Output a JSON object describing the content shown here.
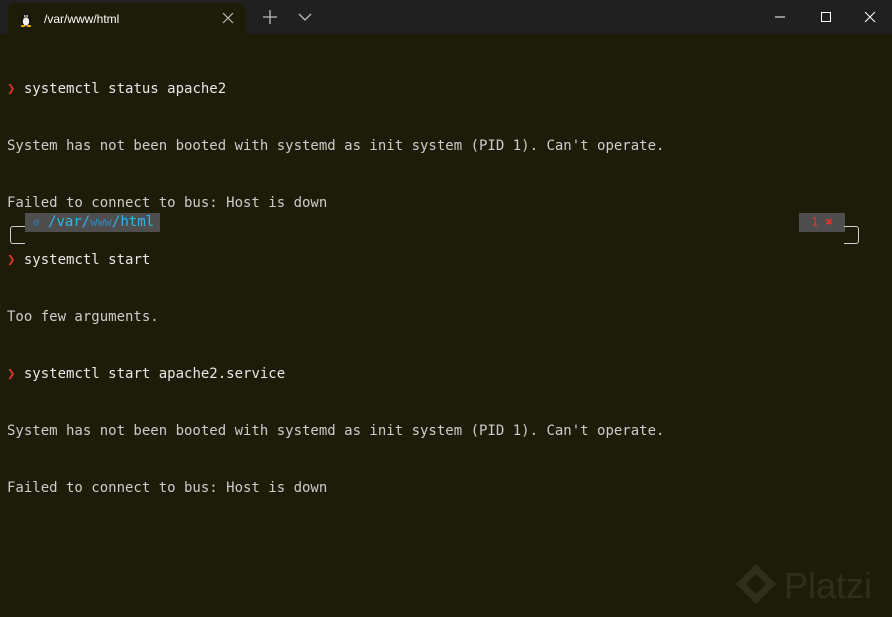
{
  "tab": {
    "title": "/var/www/html",
    "icon": "linux-penguin-icon"
  },
  "window_controls": [
    "minimize-icon",
    "maximize-icon",
    "close-icon"
  ],
  "terminal": {
    "prompt_symbol": "❯",
    "lines": [
      {
        "type": "command",
        "text": "systemctl status apache2"
      },
      {
        "type": "output",
        "text": "System has not been booted with systemd as init system (PID 1). Can't operate."
      },
      {
        "type": "output",
        "text": "Failed to connect to bus: Host is down"
      },
      {
        "type": "command",
        "text": "systemctl start"
      },
      {
        "type": "output",
        "text": "Too few arguments."
      },
      {
        "type": "command",
        "text": "systemctl start apache2.service"
      },
      {
        "type": "output",
        "text": "System has not been booted with systemd as init system (PID 1). Can't operate."
      },
      {
        "type": "output",
        "text": "Failed to connect to bus: Host is down"
      }
    ]
  },
  "prompt": {
    "lock_glyph": "⌀",
    "path_prefix": "/var/",
    "path_middle": "www",
    "path_suffix": "/html",
    "status": "1 ✖"
  },
  "watermark": {
    "text": "Platzi"
  },
  "colors": {
    "background": "#1d1c08",
    "titlebar": "#202020",
    "prompt_arrow": "#e0352a",
    "path": "#2fb4ee",
    "segment_bg": "#4e4e4e"
  }
}
